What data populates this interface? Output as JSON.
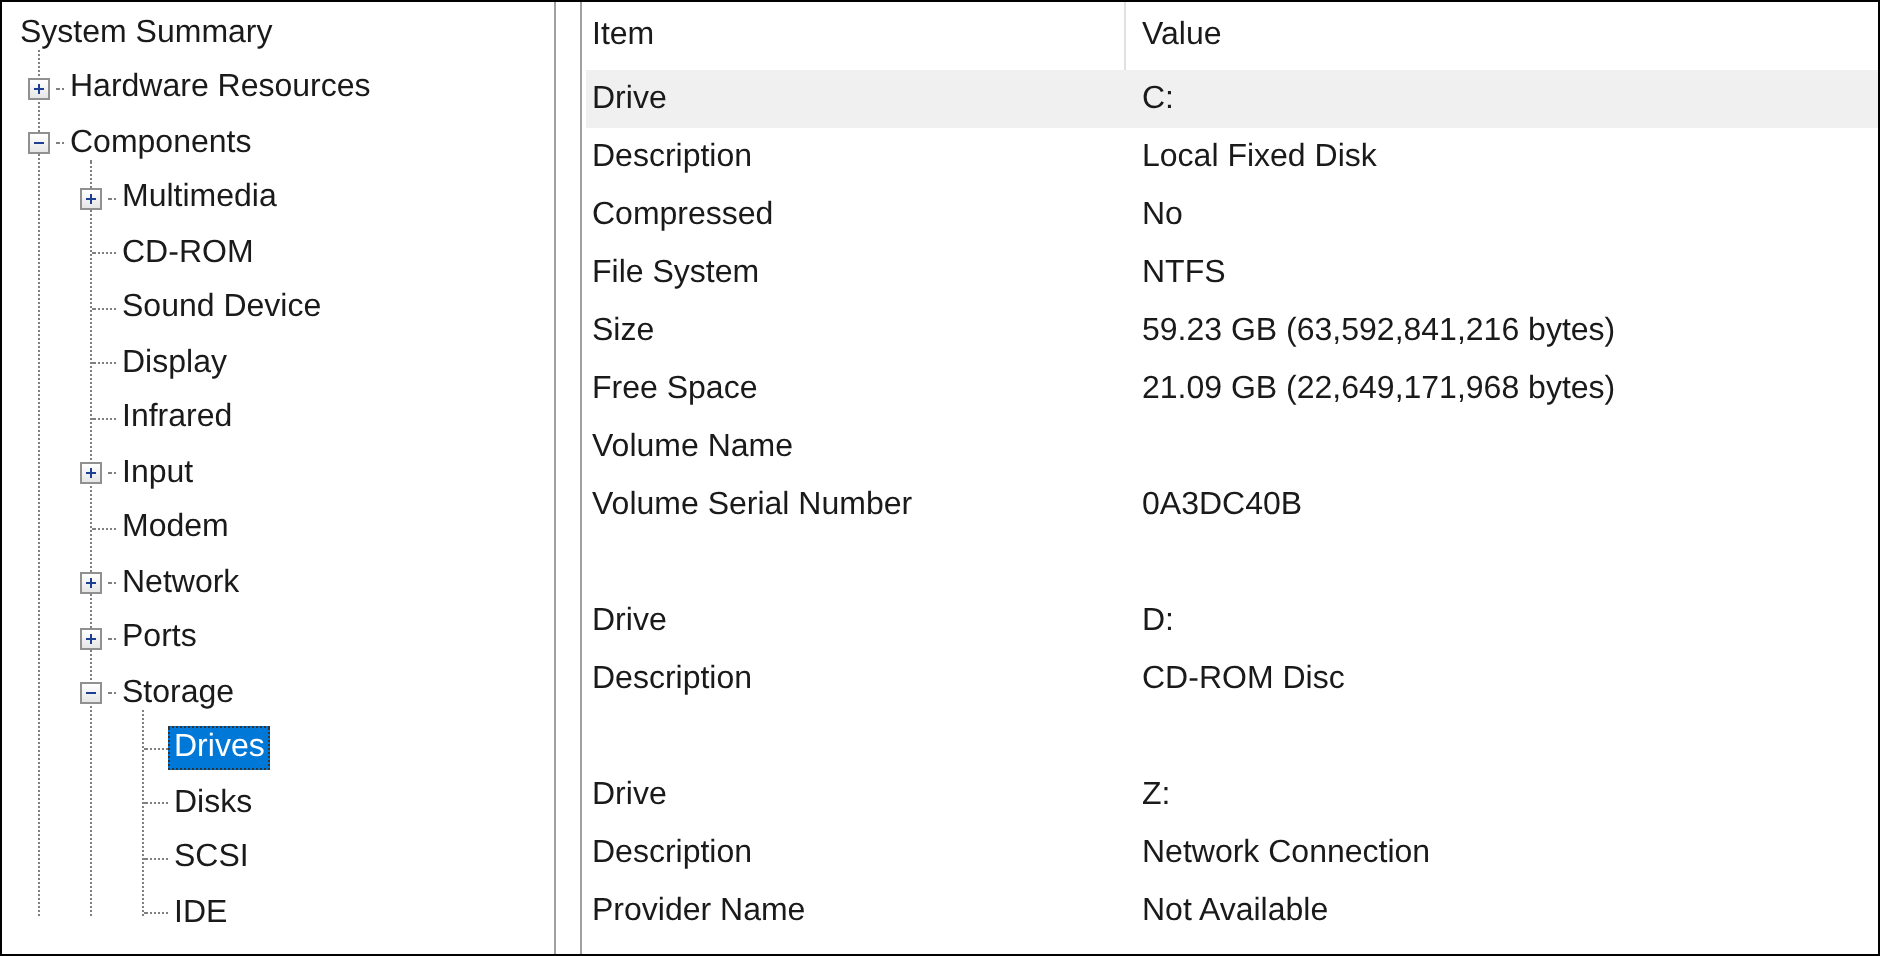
{
  "tree": {
    "label": "System Summary",
    "kind": "root",
    "selected": false,
    "children": [
      {
        "label": "Hardware Resources",
        "kind": "folder",
        "expanded": false,
        "selected": false
      },
      {
        "label": "Components",
        "kind": "folder",
        "expanded": true,
        "selected": false,
        "children": [
          {
            "label": "Multimedia",
            "kind": "folder",
            "expanded": false,
            "selected": false
          },
          {
            "label": "CD-ROM",
            "kind": "leaf",
            "selected": false
          },
          {
            "label": "Sound Device",
            "kind": "leaf",
            "selected": false
          },
          {
            "label": "Display",
            "kind": "leaf",
            "selected": false
          },
          {
            "label": "Infrared",
            "kind": "leaf",
            "selected": false
          },
          {
            "label": "Input",
            "kind": "folder",
            "expanded": false,
            "selected": false
          },
          {
            "label": "Modem",
            "kind": "leaf",
            "selected": false
          },
          {
            "label": "Network",
            "kind": "folder",
            "expanded": false,
            "selected": false
          },
          {
            "label": "Ports",
            "kind": "folder",
            "expanded": false,
            "selected": false
          },
          {
            "label": "Storage",
            "kind": "folder",
            "expanded": true,
            "selected": false,
            "children": [
              {
                "label": "Drives",
                "kind": "leaf",
                "selected": true
              },
              {
                "label": "Disks",
                "kind": "leaf",
                "selected": false
              },
              {
                "label": "SCSI",
                "kind": "leaf",
                "selected": false
              },
              {
                "label": "IDE",
                "kind": "leaf",
                "selected": false
              }
            ]
          }
        ]
      }
    ]
  },
  "table": {
    "columns": [
      "Item",
      "Value"
    ],
    "groups": [
      {
        "rows": [
          {
            "item": "Drive",
            "value": "C:",
            "selected": true
          },
          {
            "item": "Description",
            "value": "Local Fixed Disk",
            "selected": false
          },
          {
            "item": "Compressed",
            "value": "No",
            "selected": false
          },
          {
            "item": "File System",
            "value": "NTFS",
            "selected": false
          },
          {
            "item": "Size",
            "value": "59.23 GB (63,592,841,216 bytes)",
            "selected": false
          },
          {
            "item": "Free Space",
            "value": "21.09 GB (22,649,171,968 bytes)",
            "selected": false
          },
          {
            "item": "Volume Name",
            "selected": false
          },
          {
            "item": "Volume Serial Number",
            "value": "0A3DC40B",
            "selected": false
          }
        ]
      },
      {
        "rows": [
          {
            "item": "Drive",
            "value": "D:",
            "selected": false
          },
          {
            "item": "Description",
            "value": "CD-ROM Disc",
            "selected": false
          }
        ]
      },
      {
        "rows": [
          {
            "item": "Drive",
            "value": "Z:",
            "selected": false
          },
          {
            "item": "Description",
            "value": "Network Connection",
            "selected": false
          },
          {
            "item": "Provider Name",
            "value": "Not Available",
            "selected": false
          }
        ]
      }
    ]
  }
}
